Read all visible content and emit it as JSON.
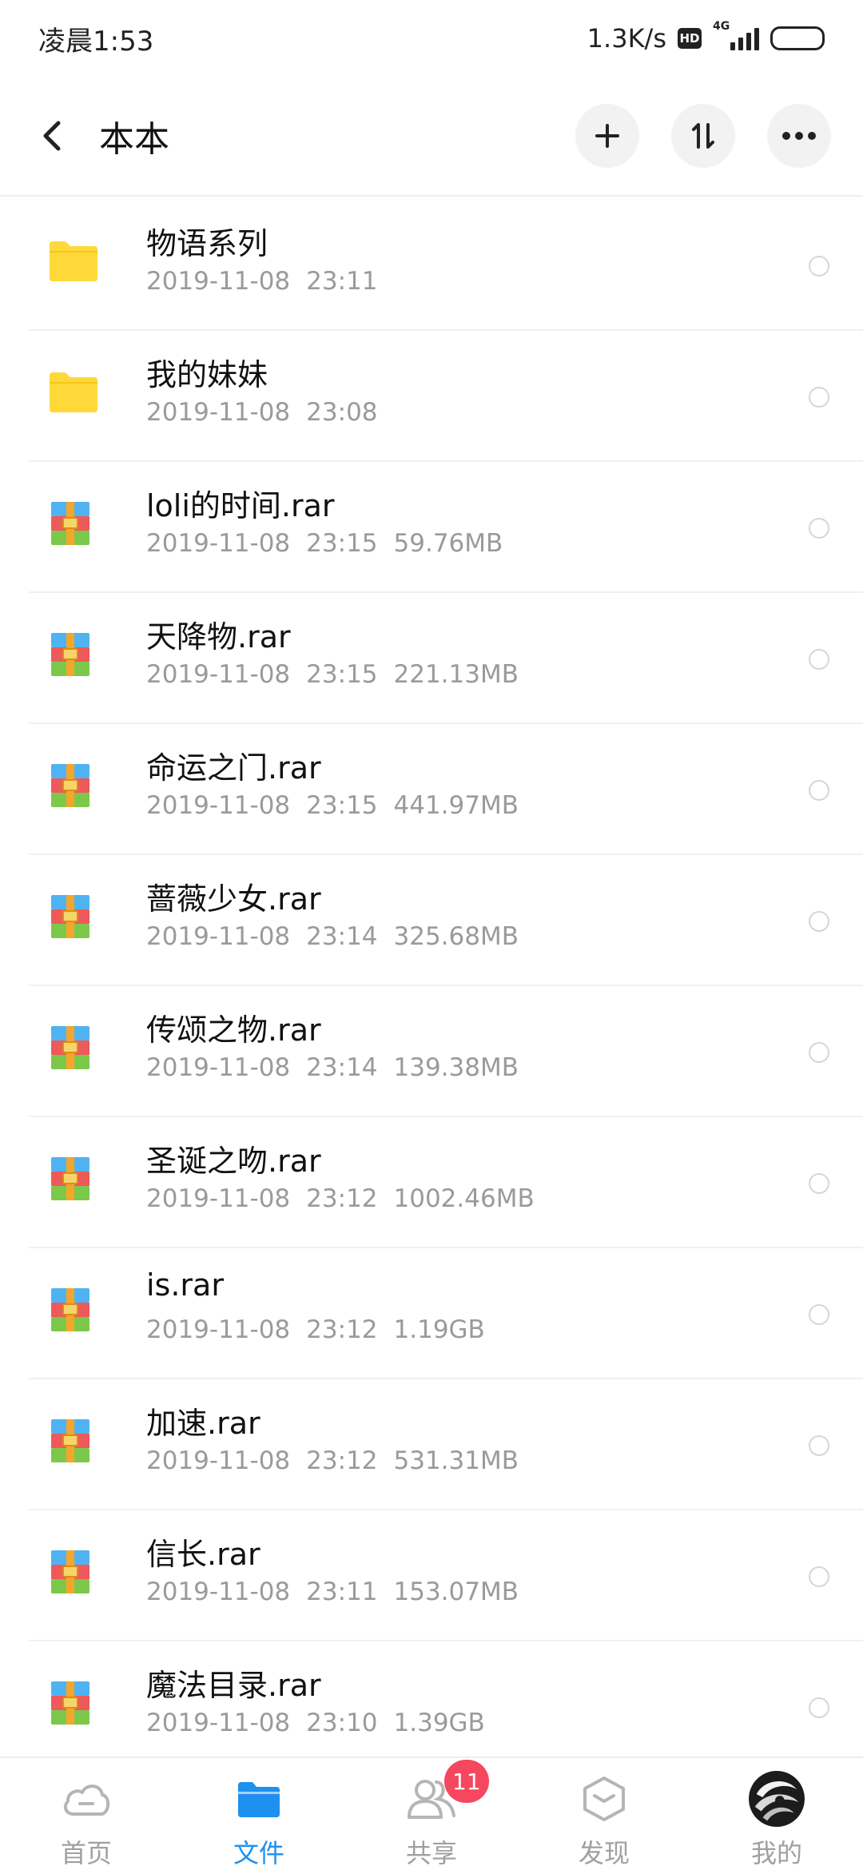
{
  "status_bar": {
    "time": "凌晨1:53",
    "net_speed": "1.3K/s",
    "hd": "HD",
    "network_type": "4G",
    "icons": [
      "hd-badge-icon",
      "signal-icon",
      "battery-icon"
    ]
  },
  "header": {
    "title": "本本",
    "back_icon": "chevron-left-icon",
    "actions": [
      "plus-icon",
      "sort-icon",
      "more-icon"
    ]
  },
  "files": [
    {
      "name": "物语系列",
      "date": "2019-11-08",
      "time": "23:11",
      "size": "",
      "type": "folder"
    },
    {
      "name": "我的妹妹",
      "date": "2019-11-08",
      "time": "23:08",
      "size": "",
      "type": "folder"
    },
    {
      "name": "loli的时间.rar",
      "date": "2019-11-08",
      "time": "23:15",
      "size": "59.76MB",
      "type": "rar"
    },
    {
      "name": "天降物.rar",
      "date": "2019-11-08",
      "time": "23:15",
      "size": "221.13MB",
      "type": "rar"
    },
    {
      "name": "命运之门.rar",
      "date": "2019-11-08",
      "time": "23:15",
      "size": "441.97MB",
      "type": "rar"
    },
    {
      "name": "蔷薇少女.rar",
      "date": "2019-11-08",
      "time": "23:14",
      "size": "325.68MB",
      "type": "rar"
    },
    {
      "name": "传颂之物.rar",
      "date": "2019-11-08",
      "time": "23:14",
      "size": "139.38MB",
      "type": "rar"
    },
    {
      "name": "圣诞之吻.rar",
      "date": "2019-11-08",
      "time": "23:12",
      "size": "1002.46MB",
      "type": "rar"
    },
    {
      "name": "is.rar",
      "date": "2019-11-08",
      "time": "23:12",
      "size": "1.19GB",
      "type": "rar"
    },
    {
      "name": "加速.rar",
      "date": "2019-11-08",
      "time": "23:12",
      "size": "531.31MB",
      "type": "rar"
    },
    {
      "name": "信长.rar",
      "date": "2019-11-08",
      "time": "23:11",
      "size": "153.07MB",
      "type": "rar"
    },
    {
      "name": "魔法目录.rar",
      "date": "2019-11-08",
      "time": "23:10",
      "size": "1.39GB",
      "type": "rar"
    }
  ],
  "bottom_nav": {
    "items": [
      {
        "label": "首页",
        "icon": "cloud-icon",
        "active": false
      },
      {
        "label": "文件",
        "icon": "folder-icon",
        "active": true
      },
      {
        "label": "共享",
        "icon": "people-icon",
        "active": false,
        "badge": "11"
      },
      {
        "label": "发现",
        "icon": "cube-icon",
        "active": false
      },
      {
        "label": "我的",
        "icon": "avatar-icon",
        "active": false
      }
    ]
  },
  "colors": {
    "accent": "#1E90F0",
    "folder": "#FFD83A",
    "badge": "#F5475E",
    "meta_text": "#9A9A9A"
  }
}
